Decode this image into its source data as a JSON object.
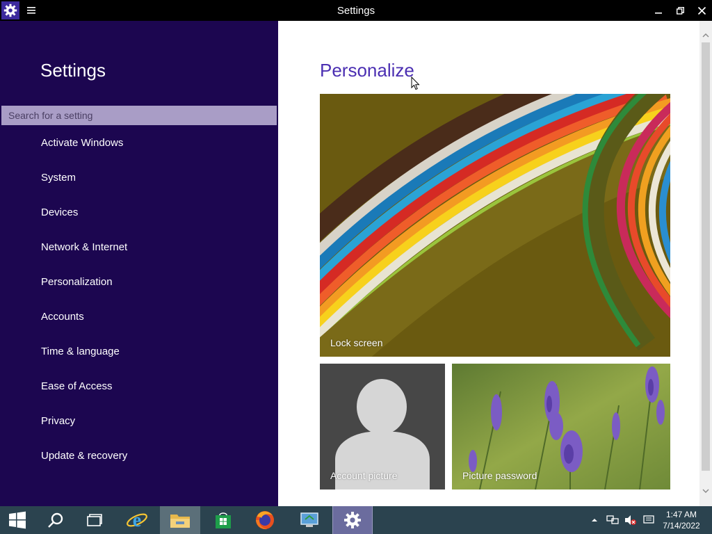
{
  "window": {
    "title": "Settings",
    "app_icon": "gear-icon",
    "menu_icon": "hamburger-icon"
  },
  "sidebar": {
    "title": "Settings",
    "search_placeholder": "Search for a setting",
    "items": [
      {
        "label": "Activate Windows"
      },
      {
        "label": "System"
      },
      {
        "label": "Devices"
      },
      {
        "label": "Network & Internet"
      },
      {
        "label": "Personalization"
      },
      {
        "label": "Accounts"
      },
      {
        "label": "Time & language"
      },
      {
        "label": "Ease of Access"
      },
      {
        "label": "Privacy"
      },
      {
        "label": "Update & recovery"
      }
    ]
  },
  "main": {
    "title": "Personalize",
    "tiles": [
      {
        "label": "Lock screen"
      },
      {
        "label": "Account picture"
      },
      {
        "label": "Picture password"
      }
    ]
  },
  "taskbar": {
    "apps": [
      "start-icon",
      "search-icon",
      "task-view-icon",
      "internet-explorer-icon",
      "file-explorer-icon",
      "store-icon",
      "firefox-icon",
      "remote-desktop-icon",
      "settings-icon"
    ]
  },
  "tray": {
    "time": "1:47 AM",
    "date": "7/14/2022"
  },
  "colors": {
    "sidebar_bg": "#1c0650",
    "accent": "#4b2fb2",
    "taskbar_bg": "#2b434f"
  }
}
